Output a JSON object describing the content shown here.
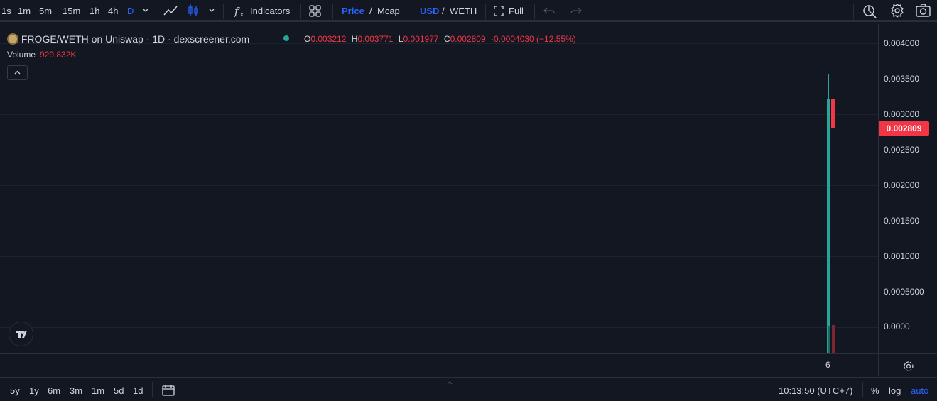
{
  "toolbar": {
    "intervals": [
      "1s",
      "1m",
      "5m",
      "15m",
      "1h",
      "4h",
      "D"
    ],
    "active_interval": "D",
    "indicators_label": "Indicators",
    "price_label": "Price",
    "price_sep": "/",
    "mcap_label": "Mcap",
    "usd_label": "USD",
    "weth_sep": "/",
    "weth_label": "WETH",
    "full_label": "Full",
    "icons": [
      "chevron-down-icon",
      "line-chart-icon",
      "candles-icon",
      "chevron-down-icon",
      "indicators-fx-icon",
      "layouts-grid-icon",
      "fullscreen-icon",
      "undo-icon",
      "redo-icon",
      "replay-icon",
      "settings-gear-icon",
      "camera-icon"
    ]
  },
  "legend": {
    "symbol": "FROGE/WETH on Uniswap · 1D · dexscreener.com",
    "status_color": "#26a69a",
    "ohlc": {
      "o_key": "O",
      "o_val": "0.003212",
      "h_key": "H",
      "h_val": "0.003771",
      "l_key": "L",
      "l_val": "0.001977",
      "c_key": "C",
      "c_val": "0.002809",
      "change": "-0.0004030 (−12.55%)"
    },
    "volume_label": "Volume",
    "volume_value": "929.832K"
  },
  "price_axis": {
    "labels": [
      "0.004000",
      "0.003500",
      "0.003000",
      "0.002500",
      "0.002000",
      "0.001500",
      "0.001000",
      "0.0005000",
      "0.0000"
    ],
    "current_price": "0.002809"
  },
  "time_axis": {
    "labels": [
      "6"
    ]
  },
  "bottom": {
    "ranges": [
      "5y",
      "1y",
      "6m",
      "3m",
      "1m",
      "5d",
      "1d"
    ],
    "clock": "10:13:50 (UTC+7)",
    "percent": "%",
    "log": "log",
    "auto": "auto"
  },
  "colors": {
    "up": "#26a69a",
    "down": "#f23645",
    "accent": "#2962ff",
    "background": "#131722"
  },
  "chart_data": {
    "type": "candlestick",
    "y_range": [
      0,
      0.004
    ],
    "candles": [
      {
        "x": "6",
        "open": 0.0,
        "high": 0.00355,
        "low": 0.0,
        "close": 0.003212,
        "color": "up"
      },
      {
        "x": "6",
        "open": 0.003212,
        "high": 0.003771,
        "low": 0.001977,
        "close": 0.002809,
        "color": "down"
      }
    ],
    "last_volume": "929.832K"
  }
}
